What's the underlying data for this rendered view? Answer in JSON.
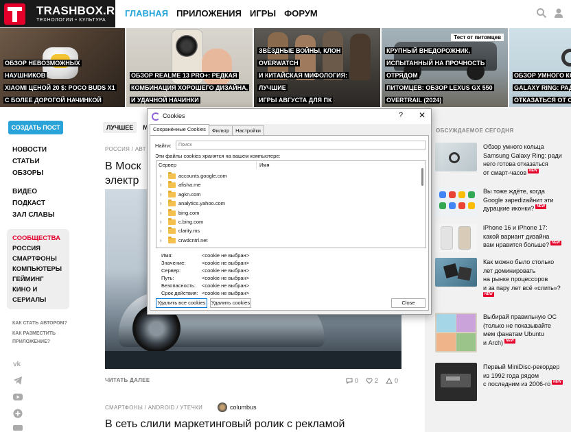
{
  "site": {
    "logo_name": "TRASHBOX.RU",
    "logo_tagline": "ТЕХНОЛОГИИ • КУЛЬТУРА",
    "nav": [
      "ГЛАВНАЯ",
      "ПРИЛОЖЕНИЯ",
      "ИГРЫ",
      "ФОРУМ"
    ],
    "active_nav": "ГЛАВНАЯ",
    "accent_color": "#25a6d9",
    "brand_color": "#e4002b"
  },
  "hero": [
    {
      "lines": [
        "ОБЗОР НЕВОЗМОЖНЫХ НАУШНИКОВ",
        "XIAOMI ЦЕНОЙ 20 $: POCO BUDS X1",
        "С БОЛЕЕ ДОРОГОЙ НАЧИНКОЙ"
      ]
    },
    {
      "lines": [
        "ОБЗОР REALME 13 PRO+: РЕДКАЯ",
        "КОМБИНАЦИЯ ХОРОШЕГО ДИЗАЙНА,",
        "И УДАЧНОЙ НАЧИНКИ"
      ]
    },
    {
      "lines": [
        "ЗВЁЗДНЫЕ ВОЙНЫ, КЛОН OVERWATCH",
        "И КИТАЙСКАЯ МИФОЛОГИЯ: ЛУЧШИЕ",
        "ИГРЫ АВГУСТА ДЛЯ ПК"
      ]
    },
    {
      "lines": [
        "КРУПНЫЙ ВНЕДОРОЖНИК,",
        "ИСПЫТАННЫЙ НА ПРОЧНОСТЬ ОТРЯДОМ",
        "ПИТОМЦЕВ: ОБЗОР LEXUS GX 550",
        "OVERTRAIL (2024)"
      ],
      "badge": "Тест от питомцев"
    },
    {
      "lines": [
        "ОБЗОР УМНОГО КОЛ",
        "GALAXY RING: РАДИ",
        "ОТКАЗАТЬСЯ ОТ СМА"
      ]
    }
  ],
  "sidebar": {
    "create_post": "СОЗДАТЬ ПОСТ",
    "group1": [
      "НОВОСТИ",
      "СТАТЬИ",
      "ОБЗОРЫ"
    ],
    "group2": [
      "ВИДЕО",
      "ПОДКАСТ",
      "ЗАЛ СЛАВЫ"
    ],
    "group3_title": "СООБЩЕСТВА",
    "group3": [
      "РОССИЯ",
      "СМАРТФОНЫ",
      "КОМПЬЮТЕРЫ",
      "ГЕЙМИНГ",
      "КИНО И",
      "СЕРИАЛЫ"
    ],
    "small_links": [
      "КАК СТАТЬ АВТОРОМ?",
      "КАК РАЗМЕСТИТЬ",
      "ПРИЛОЖЕНИЕ?"
    ],
    "social_icons": [
      "vk-icon",
      "telegram-icon",
      "youtube-icon",
      "plus-icon",
      "rss-icon"
    ]
  },
  "main": {
    "tabs": [
      "ЛУЧШЕЕ",
      "МО"
    ],
    "article1": {
      "crumb": "РОССИЯ / АВТ",
      "title": [
        "В Моск",
        "электр"
      ],
      "read_more": "ЧИТАТЬ ДАЛЕЕ",
      "comments": "0",
      "likes": "2",
      "dislikes": "0"
    },
    "article2": {
      "crumb": "СМАРТФОНЫ / ANDROID / УТЕЧКИ",
      "author": "columbus",
      "title": "В сеть слили маркетинговый ролик с рекламой"
    }
  },
  "right": {
    "header": "ОБСУЖДАЕМОЕ СЕГОДНЯ",
    "new_label": "NEW",
    "news": [
      {
        "lines": [
          "Обзор умного кольца",
          "Samsung Galaxy Ring: ради",
          "него готова отказаться",
          "от смарт-часов"
        ],
        "is_new": true
      },
      {
        "lines": [
          "Вы тоже ждёте, когда",
          "Google зарedizайнит эти",
          "дурацкие иконки?"
        ],
        "is_new": true
      },
      {
        "lines": [
          "iPhone 16 и iPhone 17:",
          "какой вариант дизайна",
          "вам нравится больше?"
        ],
        "is_new": true
      },
      {
        "lines": [
          "Как можно было столько",
          "лет доминировать",
          "на рынке процессоров",
          "и за пару лет всё «слить»?"
        ],
        "is_new": true
      },
      {
        "lines": [
          "Выбирай правильную ОС",
          "(только не показывайте",
          "мем фанатам Ubuntu",
          "и Arch)"
        ],
        "is_new": true
      },
      {
        "lines": [
          "Первый MiniDisc-рекордер",
          "из 1992 года рядом",
          "с последним из 2006-го"
        ],
        "is_new": true
      }
    ]
  },
  "dialog": {
    "title": "Cookies",
    "help": "?",
    "close_x": "✕",
    "tabs": [
      "Сохранённые Cookies",
      "Фильтр",
      "Настройки"
    ],
    "find_label": "Найти:",
    "find_placeholder": "Поиск",
    "stored_label": "Эти файлы cookies хранятся на вашем компьютере:",
    "col_server": "Сервер",
    "col_name": "Имя",
    "rows": [
      "accounts.google.com",
      "afisha.me",
      "agkn.com",
      "analytics.yahoo.com",
      "bing.com",
      "c.bing.com",
      "clarity.ms",
      "crwdcntrl.net"
    ],
    "details": [
      {
        "k": "Имя:",
        "v": "<cookie не выбран>"
      },
      {
        "k": "Значение:",
        "v": "<cookie не выбран>"
      },
      {
        "k": "Сервер:",
        "v": "<cookie не выбран>"
      },
      {
        "k": "Путь:",
        "v": "<cookie не выбран>"
      },
      {
        "k": "Безопасность:",
        "v": "<cookie не выбран>"
      },
      {
        "k": "Срок действия:",
        "v": "<cookie не выбран>"
      }
    ],
    "btn_delete_all": "Удалить все cookies",
    "btn_delete": "Удалить cookies",
    "btn_close": "Close"
  }
}
